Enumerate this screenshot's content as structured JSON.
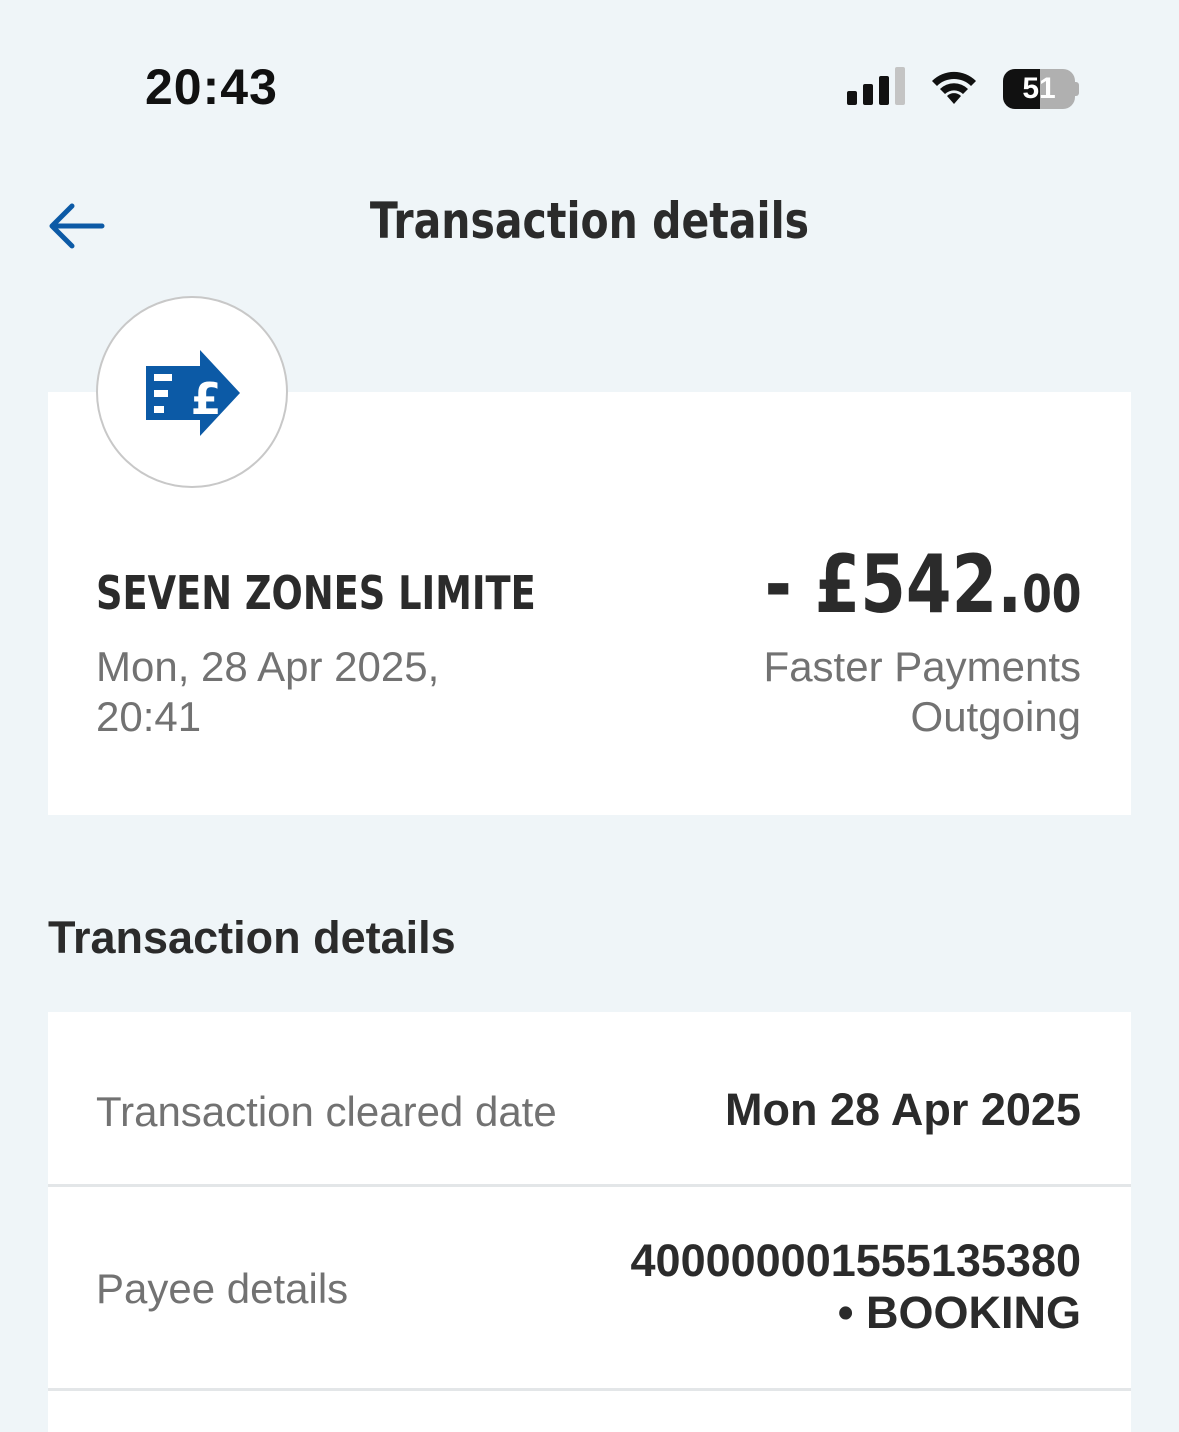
{
  "status_bar": {
    "time": "20:43",
    "battery_level": "51",
    "icons": [
      "signal-icon",
      "wifi-icon",
      "battery-icon"
    ]
  },
  "header": {
    "title": "Transaction details",
    "back_icon": "arrow-left-icon"
  },
  "summary": {
    "merchant_icon": "faster-payment-pound-icon",
    "merchant_name": "SEVEN ZONES LIMITE",
    "datetime_line1": "Mon, 28 Apr 2025,",
    "datetime_line2": "20:41",
    "amount_main": "- £542.",
    "amount_pence": "00",
    "payment_type_line1": "Faster Payments",
    "payment_type_line2": "Outgoing"
  },
  "details": {
    "heading": "Transaction details",
    "rows": [
      {
        "label": "Transaction cleared date",
        "value_line1": "Mon 28 Apr 2025"
      },
      {
        "label": "Payee details",
        "value_line1": "400000001555135380",
        "value_line2": "• BOOKING"
      }
    ]
  },
  "colors": {
    "background": "#eff5f8",
    "card": "#ffffff",
    "accent_blue": "#0c5aa6",
    "text_dark": "#2b2b2b",
    "text_muted": "#727272"
  }
}
